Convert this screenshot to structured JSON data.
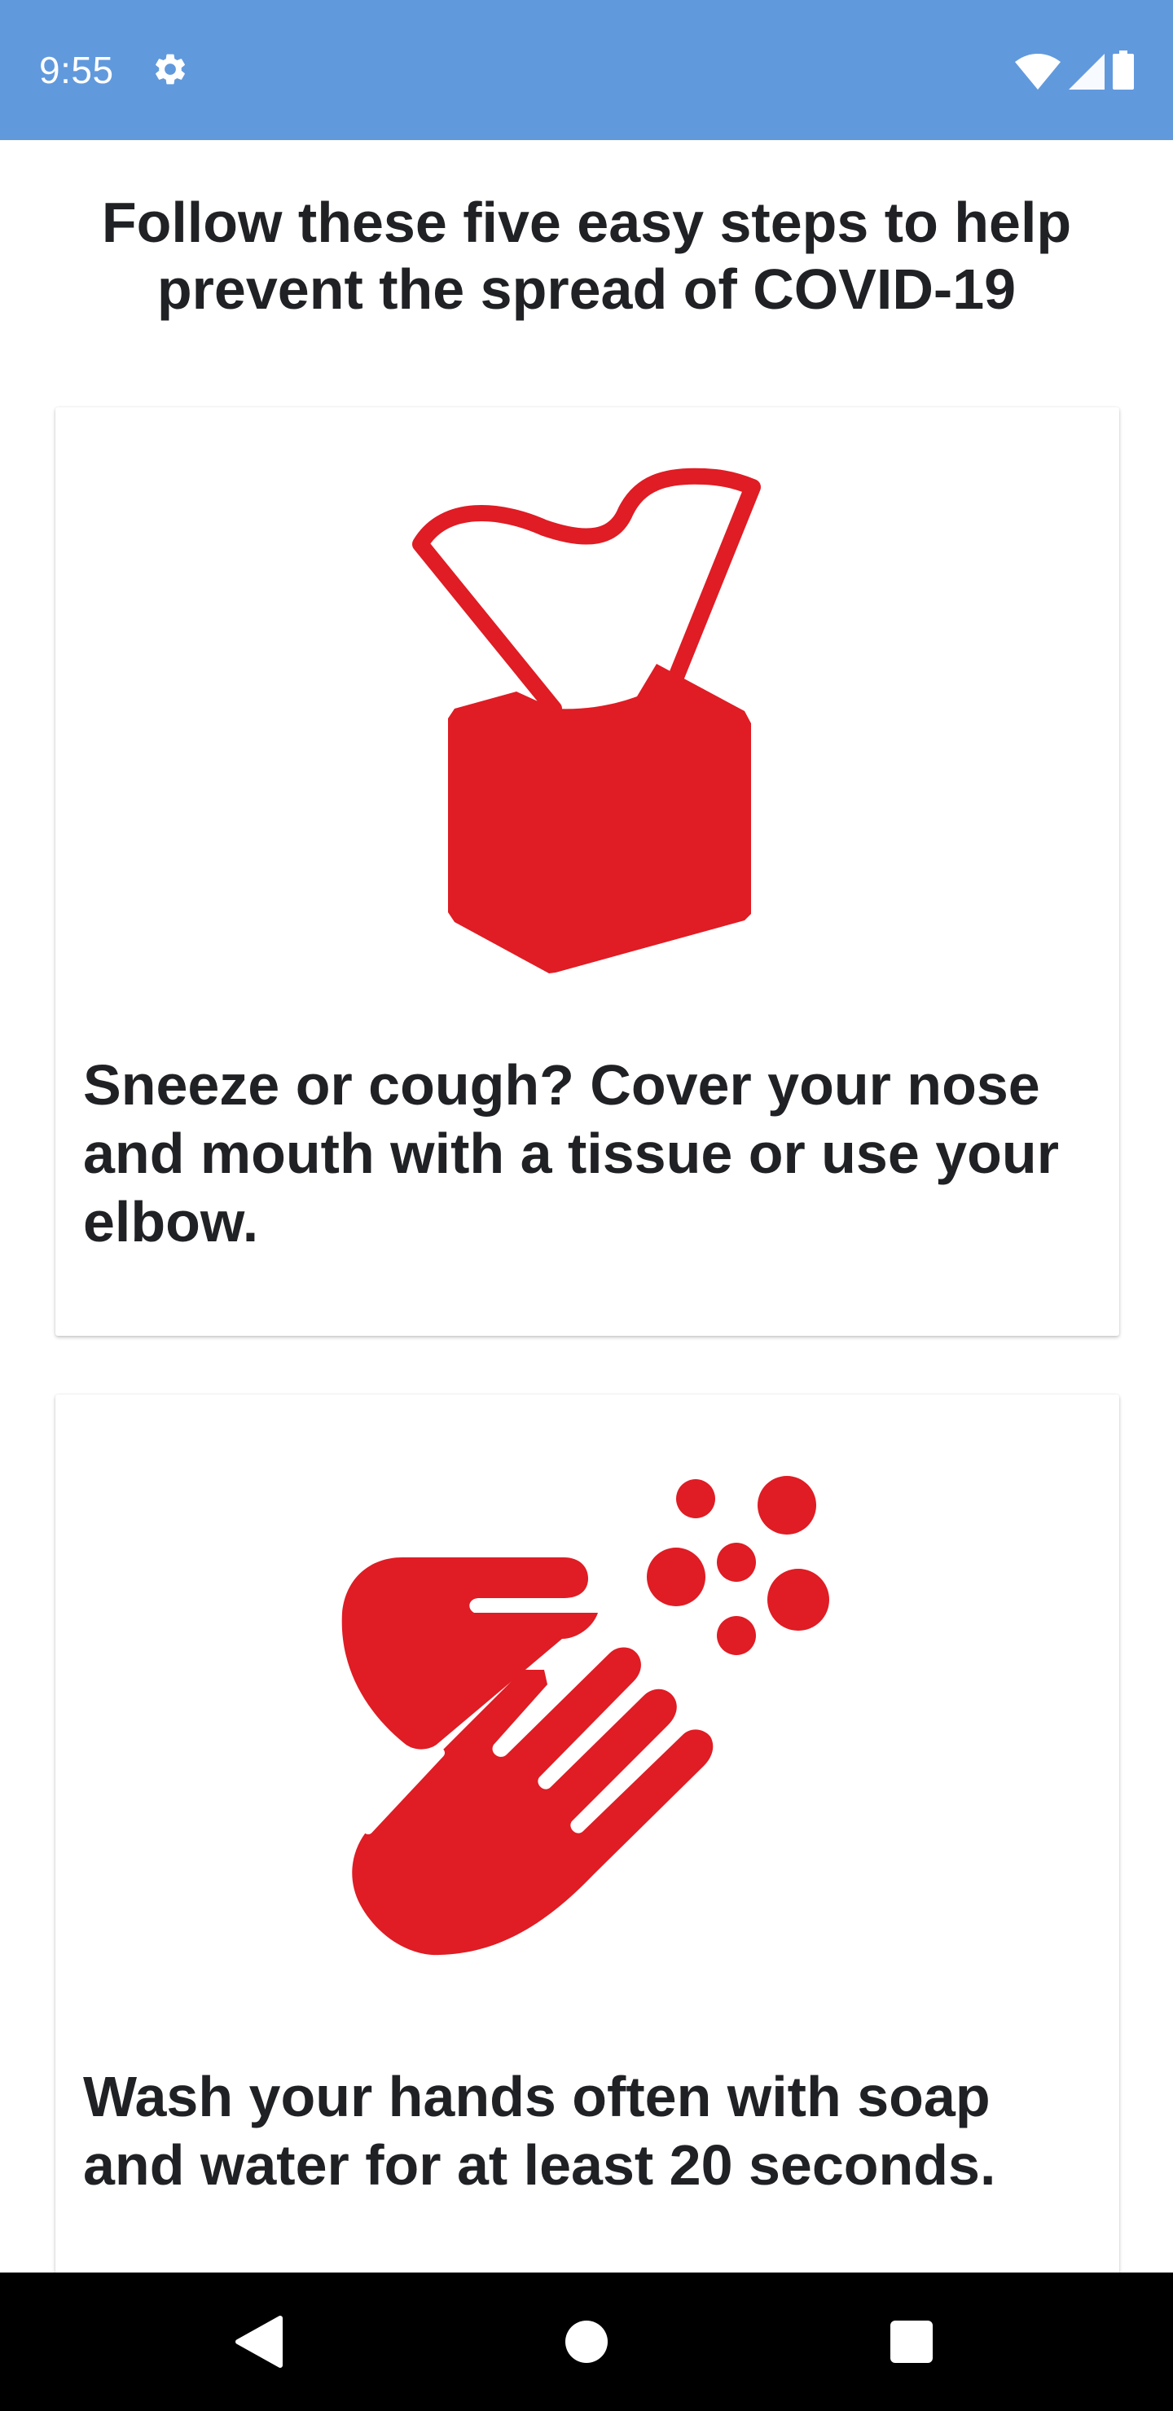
{
  "status_bar": {
    "time": "9:55",
    "icons": [
      "gear-icon",
      "wifi-icon",
      "signal-icon",
      "battery-icon"
    ],
    "background": "#6199dd"
  },
  "headline": "Follow these five easy steps to help prevent the spread of COVID-19",
  "cards": [
    {
      "illustration": "tissue-box-icon",
      "text": "Sneeze or cough?  Cover your nose and mouth with a tissue or use your elbow."
    },
    {
      "illustration": "handwashing-icon",
      "text": "Wash your hands often with soap and water for at least 20 seconds."
    }
  ],
  "nav_bar": {
    "buttons": [
      "back-icon",
      "home-icon",
      "recents-icon"
    ]
  },
  "colors": {
    "accent": "#e01c24",
    "text": "#202124"
  }
}
